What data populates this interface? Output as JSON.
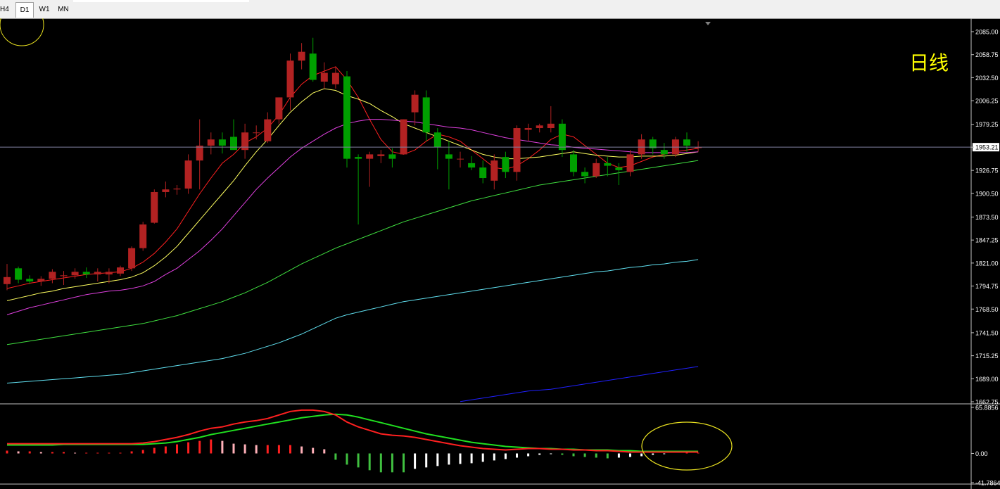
{
  "timeframe_tabs": [
    "H4",
    "D1",
    "W1",
    "MN"
  ],
  "active_tab": "D1",
  "caption": "日线",
  "current_price_label": "1953.21",
  "colors": {
    "bull": "#b22222",
    "bear": "#00a000",
    "ma_red": "#ff2020",
    "ma_yellow": "#ffff60",
    "ma_magenta": "#e040e0",
    "ma_green": "#40e040",
    "ma_cyan": "#60e0f0",
    "ma_blue": "#2020ff",
    "annotation": "#e8e020"
  },
  "chart_data": [
    {
      "type": "candlestick",
      "price_axis_ticks": [
        "2085.00",
        "2058.75",
        "2032.50",
        "2006.25",
        "1979.25",
        "1953.21",
        "1926.75",
        "1900.50",
        "1873.50",
        "1847.25",
        "1821.00",
        "1794.75",
        "1768.50",
        "1741.50",
        "1715.25",
        "1689.00",
        "1662.75"
      ],
      "ylim": [
        1662.75,
        2085.0
      ],
      "current_price": 1953.21,
      "ohlc": [
        [
          1797,
          1820,
          1790,
          1805
        ],
        [
          1815,
          1817,
          1798,
          1802
        ],
        [
          1803,
          1807,
          1797,
          1800
        ],
        [
          1800,
          1806,
          1795,
          1803
        ],
        [
          1803,
          1814,
          1798,
          1811
        ],
        [
          1806,
          1812,
          1796,
          1807
        ],
        [
          1807,
          1815,
          1803,
          1811
        ],
        [
          1811,
          1816,
          1804,
          1808
        ],
        [
          1808,
          1815,
          1800,
          1811
        ],
        [
          1808,
          1815,
          1798,
          1811
        ],
        [
          1809,
          1818,
          1806,
          1816
        ],
        [
          1815,
          1840,
          1812,
          1838
        ],
        [
          1838,
          1868,
          1835,
          1865
        ],
        [
          1867,
          1905,
          1866,
          1902
        ],
        [
          1902,
          1914,
          1896,
          1905
        ],
        [
          1905,
          1910,
          1899,
          1906
        ],
        [
          1906,
          1945,
          1900,
          1938
        ],
        [
          1938,
          1985,
          1905,
          1955
        ],
        [
          1955,
          1970,
          1945,
          1962
        ],
        [
          1962,
          1970,
          1946,
          1955
        ],
        [
          1965,
          1985,
          1955,
          1950
        ],
        [
          1950,
          1980,
          1940,
          1970
        ],
        [
          1970,
          1978,
          1962,
          1970
        ],
        [
          1960,
          1993,
          1958,
          1985
        ],
        [
          1985,
          2010,
          1980,
          2010
        ],
        [
          2010,
          2060,
          1995,
          2052
        ],
        [
          2052,
          2072,
          2042,
          2062
        ],
        [
          2060,
          2078,
          2028,
          2030
        ],
        [
          2028,
          2050,
          2020,
          2038
        ],
        [
          2025,
          2045,
          2020,
          2038
        ],
        [
          2034,
          2040,
          1930,
          1940
        ],
        [
          1942,
          1945,
          1865,
          1940
        ],
        [
          1940,
          1948,
          1908,
          1945
        ],
        [
          1943,
          1950,
          1935,
          1945
        ],
        [
          1945,
          1952,
          1930,
          1940
        ],
        [
          1945,
          1985,
          1945,
          1985
        ],
        [
          1993,
          2018,
          1978,
          2013
        ],
        [
          2010,
          2018,
          1960,
          1970
        ],
        [
          1970,
          1975,
          1928,
          1953
        ],
        [
          1945,
          1960,
          1905,
          1940
        ],
        [
          1940,
          1948,
          1930,
          1940
        ],
        [
          1935,
          1943,
          1927,
          1930
        ],
        [
          1930,
          1938,
          1912,
          1918
        ],
        [
          1915,
          1945,
          1905,
          1938
        ],
        [
          1942,
          1948,
          1918,
          1925
        ],
        [
          1925,
          1978,
          1915,
          1975
        ],
        [
          1973,
          1980,
          1960,
          1975
        ],
        [
          1975,
          1980,
          1970,
          1978
        ],
        [
          1975,
          2000,
          1970,
          1980
        ],
        [
          1980,
          1985,
          1942,
          1950
        ],
        [
          1945,
          1950,
          1920,
          1925
        ],
        [
          1925,
          1930,
          1912,
          1920
        ],
        [
          1920,
          1940,
          1918,
          1935
        ],
        [
          1935,
          1942,
          1920,
          1932
        ],
        [
          1930,
          1935,
          1910,
          1927
        ],
        [
          1925,
          1950,
          1920,
          1945
        ],
        [
          1945,
          1968,
          1940,
          1962
        ],
        [
          1962,
          1965,
          1945,
          1952
        ],
        [
          1950,
          1958,
          1940,
          1945
        ],
        [
          1945,
          1965,
          1942,
          1962
        ],
        [
          1962,
          1970,
          1948,
          1955
        ],
        [
          1953,
          1960,
          1948,
          1953
        ]
      ],
      "moving_averages": [
        {
          "color": "ma_red",
          "values": [
            1792,
            1795,
            1798,
            1800,
            1802,
            1804,
            1806,
            1808,
            1809,
            1810,
            1811,
            1815,
            1822,
            1832,
            1845,
            1860,
            1880,
            1900,
            1918,
            1935,
            1945,
            1958,
            1965,
            1975,
            1990,
            2010,
            2025,
            2035,
            2040,
            2045,
            2030,
            2010,
            1985,
            1962,
            1948,
            1945,
            1950,
            1960,
            1968,
            1965,
            1960,
            1950,
            1940,
            1930,
            1928,
            1932,
            1940,
            1950,
            1962,
            1968,
            1965,
            1955,
            1945,
            1935,
            1930,
            1932,
            1937,
            1942,
            1945,
            1948,
            1950,
            1952
          ]
        },
        {
          "color": "ma_yellow",
          "values": [
            1778,
            1781,
            1784,
            1787,
            1789,
            1792,
            1794,
            1796,
            1798,
            1800,
            1802,
            1805,
            1810,
            1818,
            1828,
            1840,
            1855,
            1870,
            1885,
            1900,
            1915,
            1932,
            1948,
            1962,
            1978,
            1993,
            2005,
            2015,
            2020,
            2018,
            2012,
            2008,
            2003,
            1995,
            1988,
            1980,
            1975,
            1970,
            1965,
            1960,
            1955,
            1950,
            1945,
            1942,
            1940,
            1940,
            1941,
            1942,
            1944,
            1946,
            1948,
            1946,
            1944,
            1943,
            1942,
            1942,
            1943,
            1943,
            1943,
            1944,
            1946,
            1948
          ]
        },
        {
          "color": "ma_magenta",
          "values": [
            1762,
            1766,
            1770,
            1773,
            1776,
            1779,
            1782,
            1785,
            1787,
            1789,
            1790,
            1792,
            1795,
            1800,
            1808,
            1815,
            1825,
            1835,
            1847,
            1860,
            1875,
            1890,
            1905,
            1918,
            1930,
            1942,
            1952,
            1960,
            1968,
            1975,
            1980,
            1983,
            1985,
            1985,
            1984,
            1983,
            1982,
            1980,
            1978,
            1976,
            1975,
            1973,
            1970,
            1967,
            1964,
            1962,
            1960,
            1958,
            1956,
            1955,
            1953,
            1952,
            1951,
            1950,
            1949,
            1948,
            1947,
            1947,
            1947,
            1947,
            1947,
            1948
          ]
        },
        {
          "color": "ma_green",
          "values": [
            1728,
            1730,
            1732,
            1734,
            1736,
            1738,
            1740,
            1742,
            1744,
            1746,
            1748,
            1750,
            1752,
            1755,
            1758,
            1761,
            1765,
            1769,
            1773,
            1777,
            1782,
            1787,
            1793,
            1799,
            1806,
            1813,
            1820,
            1826,
            1832,
            1838,
            1843,
            1848,
            1853,
            1858,
            1863,
            1868,
            1872,
            1876,
            1880,
            1884,
            1888,
            1892,
            1895,
            1898,
            1901,
            1904,
            1907,
            1910,
            1912,
            1914,
            1916,
            1918,
            1920,
            1922,
            1924,
            1926,
            1928,
            1930,
            1932,
            1934,
            1936,
            1938
          ]
        },
        {
          "color": "ma_cyan",
          "values": [
            1684,
            1685,
            1686,
            1687,
            1688,
            1689,
            1690,
            1691,
            1692,
            1693,
            1694,
            1696,
            1698,
            1700,
            1702,
            1704,
            1706,
            1708,
            1710,
            1712,
            1715,
            1718,
            1722,
            1726,
            1730,
            1735,
            1740,
            1746,
            1752,
            1758,
            1762,
            1765,
            1768,
            1771,
            1774,
            1777,
            1779,
            1781,
            1783,
            1785,
            1787,
            1789,
            1791,
            1793,
            1795,
            1797,
            1799,
            1801,
            1803,
            1805,
            1807,
            1809,
            1811,
            1812,
            1814,
            1816,
            1817,
            1819,
            1820,
            1822,
            1823,
            1825
          ]
        },
        {
          "color": "ma_blue",
          "values": [
            null,
            null,
            null,
            null,
            null,
            null,
            null,
            null,
            null,
            null,
            null,
            null,
            null,
            null,
            null,
            null,
            null,
            null,
            null,
            null,
            null,
            null,
            null,
            null,
            null,
            null,
            null,
            null,
            null,
            null,
            null,
            null,
            null,
            null,
            null,
            null,
            null,
            null,
            null,
            null,
            1663,
            1665,
            1667,
            1669,
            1671,
            1673,
            1675,
            1676,
            1677,
            1679,
            1681,
            1683,
            1685,
            1687,
            1689,
            1691,
            1693,
            1695,
            1697,
            1699,
            1701,
            1703
          ]
        }
      ]
    },
    {
      "type": "macd",
      "axis_ticks": [
        "65.8856",
        "0.00",
        "-41.7864"
      ],
      "ylim": [
        -41.7864,
        65.8856
      ],
      "macd_line": [
        14,
        14,
        14,
        14,
        14,
        14,
        14,
        14,
        14,
        14,
        14,
        14,
        15,
        17,
        20,
        23,
        27,
        32,
        36,
        38,
        42,
        45,
        47,
        50,
        55,
        60,
        62,
        62,
        60,
        55,
        45,
        38,
        33,
        28,
        26,
        25,
        23,
        20,
        17,
        14,
        11,
        9,
        7,
        6,
        5,
        6,
        7,
        7,
        6,
        6,
        5,
        5,
        4,
        4,
        3,
        2,
        2,
        2,
        2,
        2,
        2,
        2
      ],
      "signal_line": [
        12,
        12,
        12,
        12,
        12,
        13,
        13,
        13,
        13,
        13,
        13,
        13,
        13,
        14,
        15,
        17,
        20,
        23,
        27,
        30,
        33,
        36,
        39,
        42,
        45,
        48,
        51,
        53,
        55,
        56,
        55,
        52,
        48,
        44,
        40,
        36,
        32,
        28,
        25,
        22,
        19,
        16,
        14,
        12,
        10,
        9,
        8,
        7,
        7,
        6,
        6,
        5,
        5,
        5,
        4,
        4,
        3,
        3,
        3,
        3,
        3,
        3
      ],
      "histogram": [
        4,
        3,
        3,
        2,
        2,
        2,
        1,
        1,
        1,
        1,
        1,
        3,
        5,
        8,
        10,
        13,
        16,
        18,
        20,
        18,
        14,
        13,
        12,
        12,
        12,
        12,
        10,
        8,
        6,
        -9,
        -16,
        -20,
        -24,
        -27,
        -27,
        -27,
        -22,
        -20,
        -18,
        -16,
        -15,
        -14,
        -12,
        -10,
        -8,
        -6,
        -4,
        -2,
        -1,
        -2,
        -4,
        -5,
        -6,
        -7,
        -6,
        -5,
        -4,
        -2,
        -1,
        0,
        1,
        1
      ]
    }
  ]
}
